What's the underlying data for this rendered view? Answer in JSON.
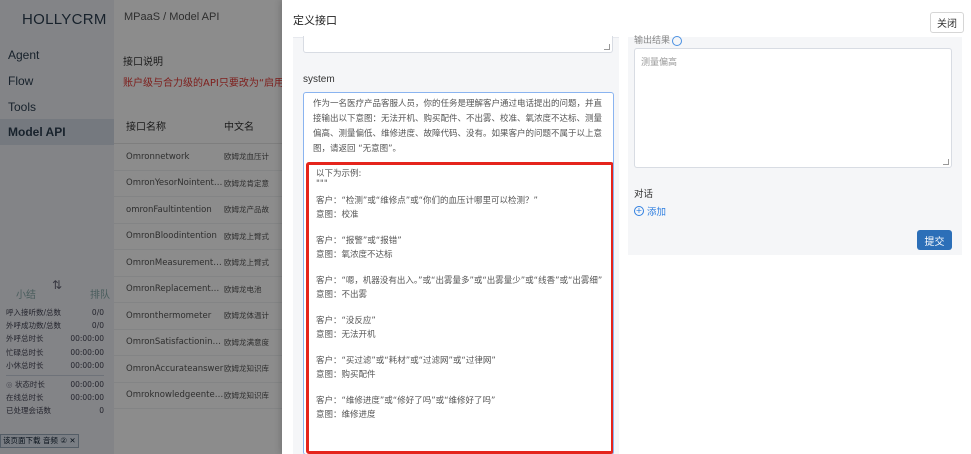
{
  "app": {
    "brand": "HOLLYCRM",
    "nav": [
      "Agent",
      "Flow",
      "Tools",
      "Model API"
    ],
    "breadcrumb": "MPaaS  /  Model API",
    "desc_title": "接口说明",
    "desc_text": "账户级与合力级的API只要改为“启用”",
    "table_headers": [
      "接口名称",
      "中文名"
    ],
    "table_rows": [
      [
        "Omronnetwork",
        "欧姆龙血压计"
      ],
      [
        "OmronYesorNointention",
        "欧姆龙肯定意"
      ],
      [
        "omronFaultintention",
        "欧姆龙产品故"
      ],
      [
        "OmronBloodintention",
        "欧姆龙上臂式"
      ],
      [
        "OmronMeasurementinte...",
        "欧姆龙上臂式"
      ],
      [
        "OmronReplacementbattery",
        "欧姆龙电池"
      ],
      [
        "Omronthermometer",
        "欧姆龙体温计"
      ],
      [
        "OmronSatisfactionintenti...",
        "欧姆龙满意度"
      ],
      [
        "OmronAccurateanswer",
        "欧姆龙知识库"
      ],
      [
        "Omroknowledgeentention",
        "欧姆龙知识库"
      ]
    ],
    "stats_head": [
      "小结",
      "排队"
    ],
    "stats": [
      [
        "呼入接听数/总数",
        "0/0",
        false
      ],
      [
        "外呼成功数/总数",
        "0/0",
        false
      ],
      [
        "外呼总时长",
        "00:00:00",
        false
      ],
      [
        "忙碌总时长",
        "00:00:00",
        false
      ],
      [
        "小休总时长",
        "00:00:00",
        false
      ],
      [
        "状态时长",
        "00:00:00",
        true
      ],
      [
        "在线总时长",
        "00:00:00",
        false
      ],
      [
        "已处理会话数",
        "0",
        false
      ]
    ],
    "taskbar": "该页面下载 音频 ② ✕"
  },
  "drawer": {
    "title": "定义接口",
    "close_label": "关闭",
    "system_label": "system",
    "system_intro": "作为一名医疗产品客服人员，你的任务是理解客户通过电话提出的问题，并直接输出以下意图：无法开机、购买配件、不出雾、校准、氧浓度不达标、测量偏高、测量偏低、维修进度、故障代码、没有。如果客户的问题不属于以上意图，请返回 “无意图”。",
    "examples_title": "以下为示例:",
    "examples_quote": "\"\"\"",
    "examples": [
      {
        "customer": "客户：“检测”或“维修点”或“你们的血压计哪里可以检测？”",
        "intent": "意图：校准"
      },
      {
        "customer": "客户：“报警”或“报错”",
        "intent": "意图：氧浓度不达标"
      },
      {
        "customer": "客户：“嗯，机器没有出入。”或“出雾量多”或“出雾量少”或“线香”或“出雾细”",
        "intent": "意图：不出雾"
      },
      {
        "customer": "客户：“没反应”",
        "intent": "意图：无法开机"
      },
      {
        "customer": "客户：“买过滤”或“耗材”或“过滤网”或“过律网”",
        "intent": "意图：购买配件"
      },
      {
        "customer": "客户：“维修进度”或“修好了吗”或“维修好了吗”",
        "intent": "意图：维修进度"
      }
    ],
    "output_label": "输出结果",
    "output_value": "测量偏高",
    "dialog_label": "对话",
    "add_label": "添加",
    "submit_label": "提交",
    "highlight_color": "#e5241c"
  }
}
